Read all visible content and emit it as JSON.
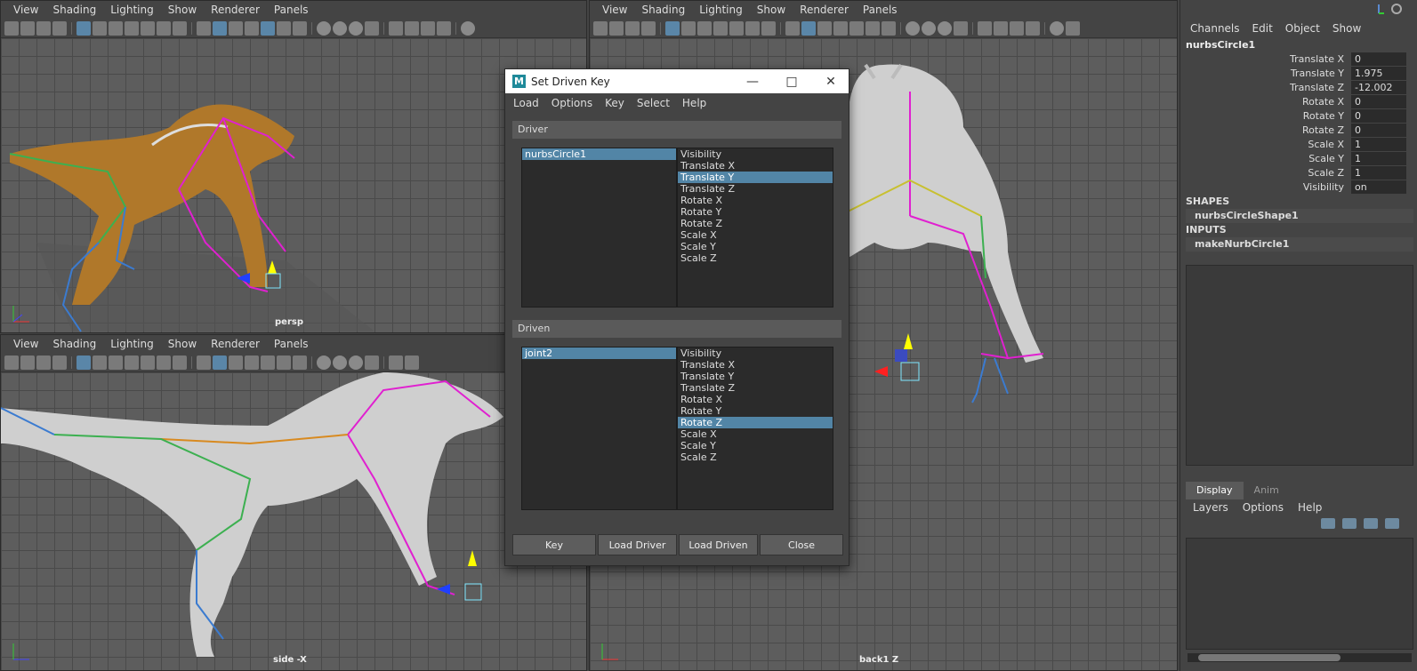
{
  "viewport_menu": [
    "View",
    "Shading",
    "Lighting",
    "Show",
    "Renderer",
    "Panels"
  ],
  "viewports": {
    "persp": {
      "label": "persp"
    },
    "side": {
      "label": "side -X"
    },
    "back": {
      "label": "back1 Z"
    }
  },
  "dialog": {
    "title": "Set Driven Key",
    "menu": [
      "Load",
      "Options",
      "Key",
      "Select",
      "Help"
    ],
    "driver_header": "Driver",
    "driven_header": "Driven",
    "driver_object": "nurbsCircle1",
    "driven_object": "joint2",
    "attributes": [
      "Visibility",
      "Translate X",
      "Translate Y",
      "Translate Z",
      "Rotate X",
      "Rotate Y",
      "Rotate Z",
      "Scale X",
      "Scale Y",
      "Scale Z"
    ],
    "driver_selected": "Translate Y",
    "driven_selected": "Rotate Z",
    "buttons": [
      "Key",
      "Load Driver",
      "Load Driven",
      "Close"
    ]
  },
  "channel_box": {
    "menu": [
      "Channels",
      "Edit",
      "Object",
      "Show"
    ],
    "object": "nurbsCircle1",
    "channels": [
      {
        "label": "Translate X",
        "value": "0"
      },
      {
        "label": "Translate Y",
        "value": "1.975"
      },
      {
        "label": "Translate Z",
        "value": "-12.002"
      },
      {
        "label": "Rotate X",
        "value": "0"
      },
      {
        "label": "Rotate Y",
        "value": "0"
      },
      {
        "label": "Rotate Z",
        "value": "0"
      },
      {
        "label": "Scale X",
        "value": "1"
      },
      {
        "label": "Scale Y",
        "value": "1"
      },
      {
        "label": "Scale Z",
        "value": "1"
      },
      {
        "label": "Visibility",
        "value": "on"
      }
    ],
    "shapes_header": "SHAPES",
    "shape_node": "nurbsCircleShape1",
    "inputs_header": "INPUTS",
    "input_node": "makeNurbCircle1"
  },
  "layer_editor": {
    "tabs": [
      "Display",
      "Anim"
    ],
    "menu": [
      "Layers",
      "Options",
      "Help"
    ]
  },
  "colors": {
    "viewport_bg": "#5d5d5d",
    "selection": "#5285a6",
    "joint_magenta": "#e020d0",
    "mesh_orange": "#b0782a",
    "mesh_grey": "#cfcfcf"
  }
}
